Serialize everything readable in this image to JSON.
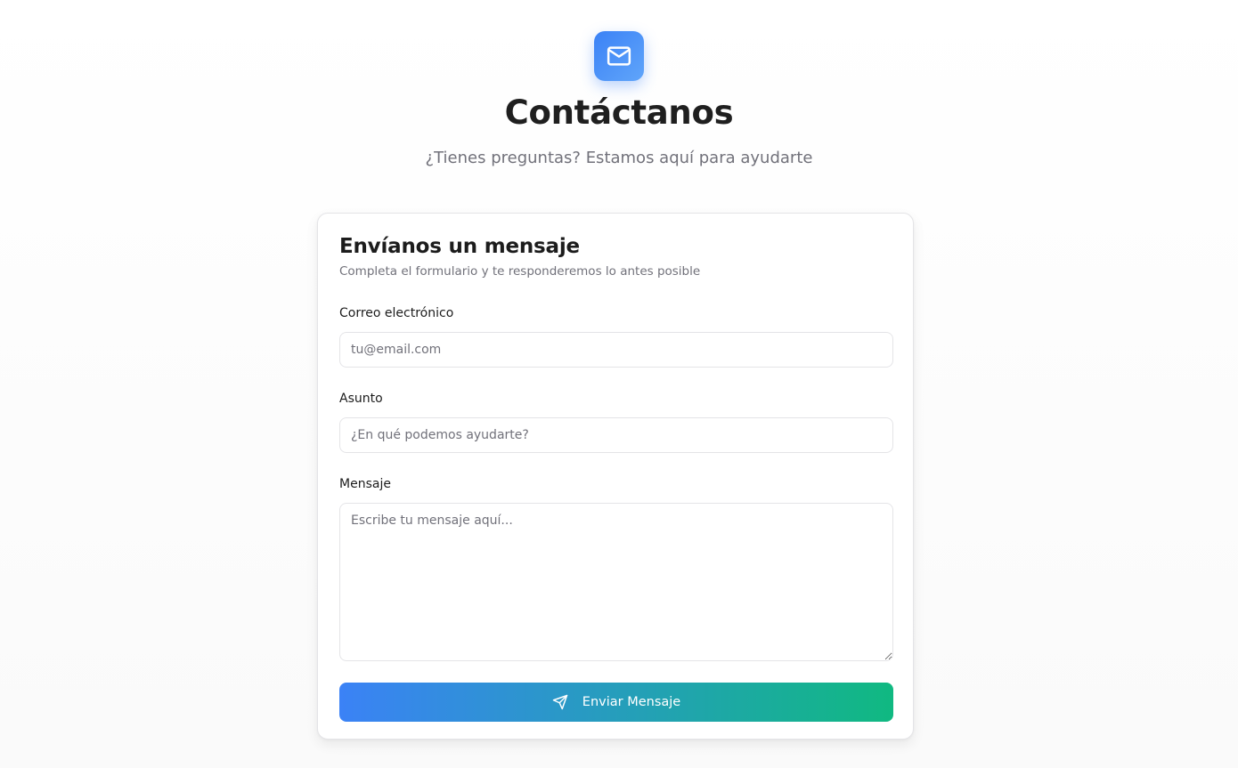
{
  "header": {
    "logo_icon": "mail-icon",
    "title": "Contáctanos",
    "subtitle": "¿Tienes preguntas? Estamos aquí para ayudarte"
  },
  "form": {
    "title": "Envíanos un mensaje",
    "subtitle": "Completa el formulario y te responderemos lo antes posible",
    "email": {
      "label": "Correo electrónico",
      "value": "",
      "placeholder": "tu@email.com"
    },
    "subject": {
      "label": "Asunto",
      "value": "",
      "placeholder": "¿En qué podemos ayudarte?"
    },
    "message": {
      "label": "Mensaje",
      "value": "",
      "placeholder": "Escribe tu mensaje aquí..."
    },
    "submit": {
      "label": "Enviar Mensaje",
      "icon": "send-icon"
    }
  },
  "colors": {
    "accent_start": "#3b82f6",
    "accent_end": "#10b981",
    "logo_tile": "#3b82f6"
  }
}
